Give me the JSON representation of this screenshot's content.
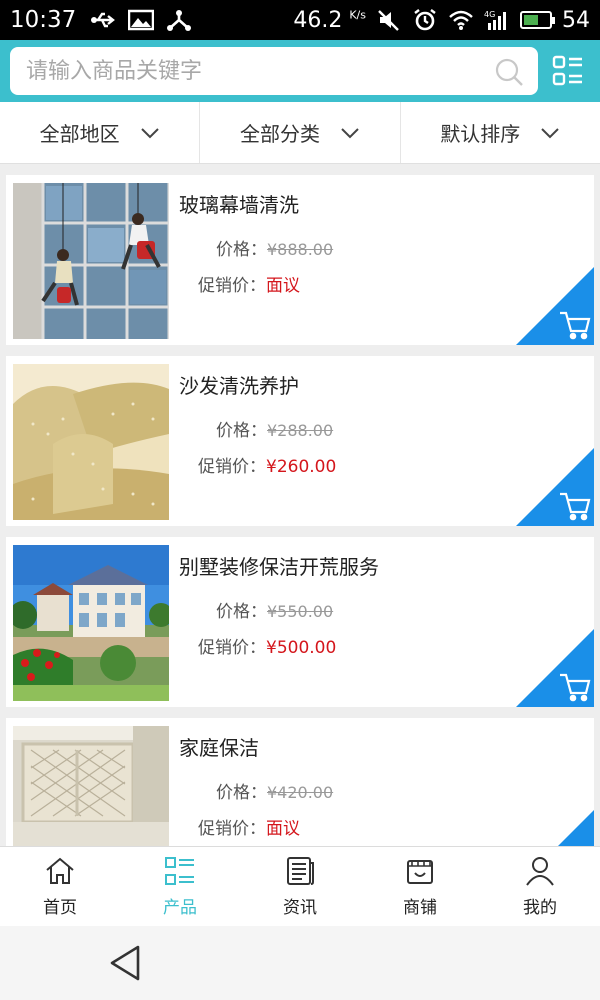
{
  "status_bar": {
    "time": "10:37",
    "network_speed": "46.2",
    "network_speed_unit": "K/s",
    "battery_percent": "54",
    "signal_label": "4G"
  },
  "search": {
    "placeholder": "请输入商品关键字"
  },
  "filters": [
    {
      "label": "全部地区"
    },
    {
      "label": "全部分类"
    },
    {
      "label": "默认排序"
    }
  ],
  "labels": {
    "price": "价格：",
    "promo_price": "促销价："
  },
  "products": [
    {
      "title": "玻璃幕墙清洗",
      "price": "¥888.00",
      "promo_price": "面议"
    },
    {
      "title": "沙发清洗养护",
      "price": "¥288.00",
      "promo_price": "¥260.00"
    },
    {
      "title": "别墅装修保洁开荒服务",
      "price": "¥550.00",
      "promo_price": "¥500.00"
    },
    {
      "title": "家庭保洁",
      "price": "¥420.00",
      "promo_price": "面议"
    }
  ],
  "bottom_nav": [
    {
      "label": "首页",
      "icon": "home-icon"
    },
    {
      "label": "产品",
      "icon": "product-list-icon",
      "active": true
    },
    {
      "label": "资讯",
      "icon": "news-icon"
    },
    {
      "label": "商铺",
      "icon": "shop-icon"
    },
    {
      "label": "我的",
      "icon": "user-icon"
    }
  ],
  "colors": {
    "accent": "#3cbfcd",
    "cart_corner": "#1a8fe8",
    "promo_price": "#d4161c"
  }
}
